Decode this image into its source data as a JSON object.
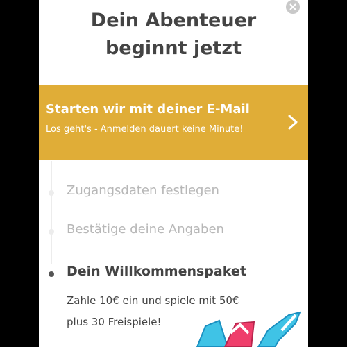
{
  "dialog": {
    "title_line1": "Dein Abenteuer",
    "title_line2": "beginnt jetzt",
    "close_icon": "close-icon"
  },
  "cta": {
    "title": "Starten wir mit deiner E-Mail",
    "subtitle": "Los geht's - Anmelden dauert keine Minute!",
    "icon": "chevron-right-icon",
    "background_color": "#e0ad37"
  },
  "steps": [
    {
      "label": "Zugangsdaten festlegen",
      "state": "inactive"
    },
    {
      "label": "Bestätige deine Angaben",
      "state": "inactive"
    },
    {
      "label": "Dein Willkommenspaket",
      "state": "active"
    }
  ],
  "welcome": {
    "line1": "Zahle 10€ ein und spiele mit 50€",
    "line2": "plus 30 Freispiele!"
  },
  "colors": {
    "text_dark": "#444444",
    "text_muted": "#b7b7b7",
    "timeline": "#ececec"
  }
}
